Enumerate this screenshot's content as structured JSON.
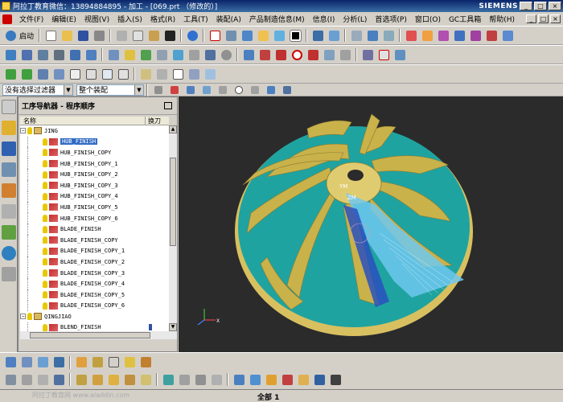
{
  "window": {
    "title": "阿拉丁教育微信：13894884895 - 加工 - [069.prt （修改的）]",
    "brand": "SIEMENS",
    "controls": [
      "_",
      "□",
      "×"
    ]
  },
  "menu": [
    "文件(F)",
    "编辑(E)",
    "视图(V)",
    "插入(S)",
    "格式(R)",
    "工具(T)",
    "装配(A)",
    "产品制造信息(M)",
    "信息(I)",
    "分析(L)",
    "首选项(P)",
    "窗口(O)",
    "GC工具箱",
    "帮助(H)"
  ],
  "toolbar": {
    "start_label": "启动",
    "filter_select": "没有选择过滤器",
    "assembly_select": "整个装配"
  },
  "navigator": {
    "title": "工序导航器 - 程序顺序",
    "columns": {
      "name": "名称",
      "tool_change": "换刀"
    },
    "groups": [
      {
        "name": "JING"
      },
      {
        "name": "QINGJIAO"
      }
    ],
    "operations": [
      "HUB_FINISH",
      "HUB_FINISH_COPY",
      "HUB_FINISH_COPY_1",
      "HUB_FINISH_COPY_2",
      "HUB_FINISH_COPY_3",
      "HUB_FINISH_COPY_4",
      "HUB_FINISH_COPY_5",
      "HUB_FINISH_COPY_6",
      "BLADE_FINISH",
      "BLADE_FINISH_COPY",
      "BLADE_FINISH_COPY_1",
      "BLADE_FINISH_COPY_2",
      "BLADE_FINISH_COPY_3",
      "BLADE_FINISH_COPY_4",
      "BLADE_FINISH_COPY_5",
      "BLADE_FINISH_COPY_6",
      "BLEND_FINISH"
    ],
    "selected": "HUB_FINISH"
  },
  "viewport": {
    "axis_labels": {
      "y": "YM",
      "z": "ZM",
      "x": "X"
    }
  },
  "status": {
    "text": "全部 1",
    "watermark": "阿拉丁教育网 www.aladdin.com"
  },
  "colors": {
    "hub": "#1fa3a0",
    "blade": "#c9b24a",
    "toolpath": "#6fc8ef",
    "background": "#2b2b2b"
  }
}
